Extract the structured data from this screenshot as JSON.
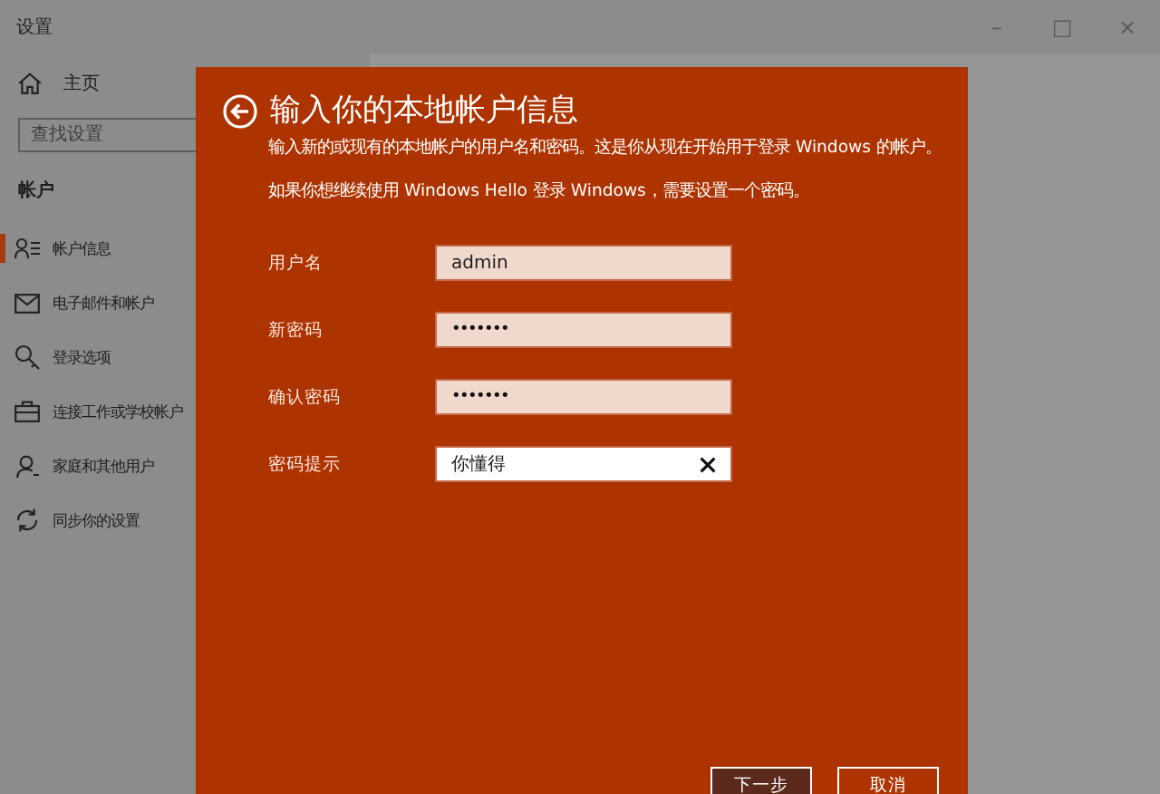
{
  "window": {
    "title": "设置",
    "controls": [
      "–",
      "□",
      "×"
    ]
  },
  "sidebar": {
    "home": "主页",
    "search": {
      "placeholder": "查找设置"
    },
    "heading": "帐户",
    "items": [
      {
        "label": "帐户信息",
        "selected": true
      },
      {
        "label": "电子邮件和帐户",
        "selected": false
      },
      {
        "label": "登录选项",
        "selected": false
      },
      {
        "label": "连接工作或学校帐户",
        "selected": false
      },
      {
        "label": "家庭和其他用户",
        "selected": false
      },
      {
        "label": "同步你的设置",
        "selected": false
      }
    ]
  },
  "dialog": {
    "title": "输入你的本地帐户信息",
    "paragraphs": [
      "输入新的或现有的本地帐户的用户名和密码。这是你从现在开始用于登录 Windows 的帐户。",
      "如果你想继续使用 Windows Hello 登录 Windows，需要设置一个密码。"
    ],
    "fields": [
      {
        "label": "用户名",
        "kind": "text",
        "value": "admin",
        "focused": false
      },
      {
        "label": "新密码",
        "kind": "password",
        "value": "•••••••",
        "focused": false
      },
      {
        "label": "确认密码",
        "kind": "password",
        "value": "•••••••",
        "focused": false
      },
      {
        "label": "密码提示",
        "kind": "text",
        "value": "你懂得",
        "focused": true
      }
    ],
    "buttons": [
      {
        "label": "下一步",
        "kind": "primary"
      },
      {
        "label": "取消",
        "kind": "secondary"
      }
    ]
  }
}
